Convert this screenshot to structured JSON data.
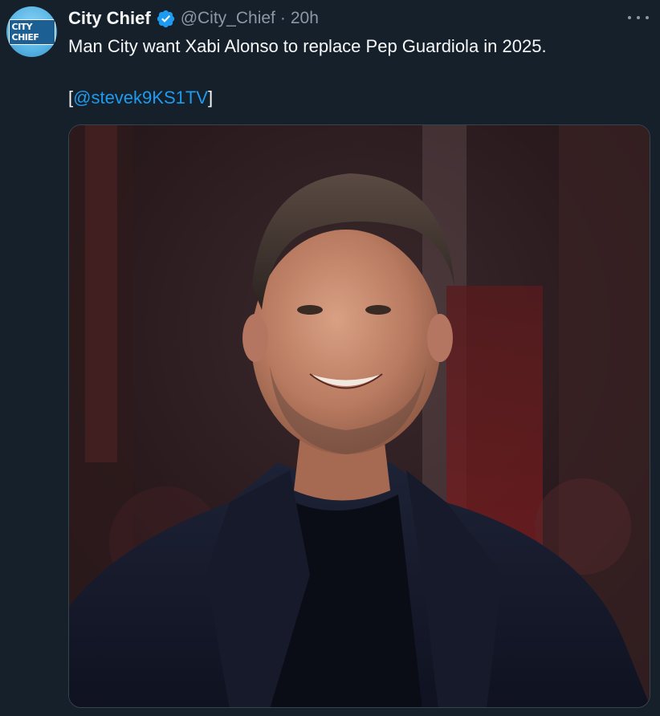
{
  "author": {
    "avatar_text": "CITY CHIEF",
    "name": "City Chief",
    "handle": "@City_Chief",
    "separator": "·",
    "time": "20h",
    "verified": true
  },
  "tweet": {
    "text": "Man City want Xabi Alonso to replace Pep Guardiola in 2025.",
    "mention_open": "[",
    "mention": "@stevek9KS1TV",
    "mention_close": "]"
  },
  "media": {
    "alt": "Smiling man with short dark hair and stubble wearing a dark navy coat over a black crew-neck, in front of a blurred red stadium background"
  },
  "icons": {
    "verified": "verified-badge-icon",
    "more": "more-dots-icon"
  },
  "colors": {
    "background": "#15202b",
    "text": "#f7f9f9",
    "secondary": "#8b98a5",
    "link": "#1d9bf0",
    "verified": "#1d9bf0"
  }
}
